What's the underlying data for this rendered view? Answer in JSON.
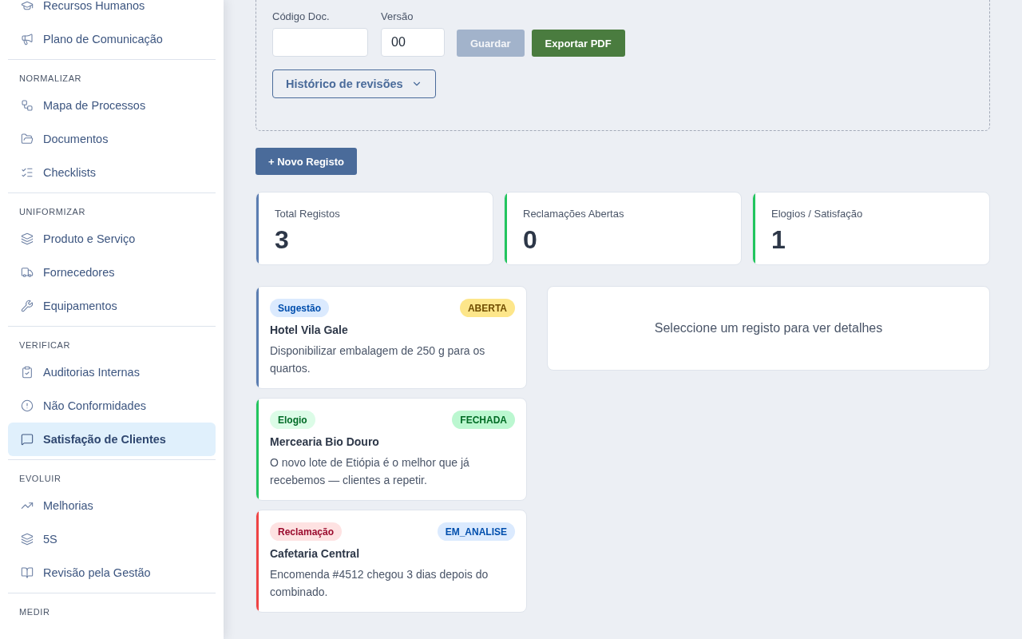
{
  "sidebar": {
    "sections": [
      {
        "items": [
          {
            "label": "Recursos Humanos",
            "selected": false
          },
          {
            "label": "Plano de Comunicação",
            "selected": false
          }
        ]
      },
      {
        "heading": "NORMALIZAR",
        "items": [
          {
            "label": "Mapa de Processos",
            "selected": false
          },
          {
            "label": "Documentos",
            "selected": false
          },
          {
            "label": "Checklists",
            "selected": false
          }
        ]
      },
      {
        "heading": "UNIFORMIZAR",
        "items": [
          {
            "label": "Produto e Serviço",
            "selected": false
          },
          {
            "label": "Fornecedores",
            "selected": false
          },
          {
            "label": "Equipamentos",
            "selected": false
          }
        ]
      },
      {
        "heading": "VERIFICAR",
        "items": [
          {
            "label": "Auditorias Internas",
            "selected": false
          },
          {
            "label": "Não Conformidades",
            "selected": false
          },
          {
            "label": "Satisfação de Clientes",
            "selected": true
          }
        ]
      },
      {
        "heading": "EVOLUIR",
        "items": [
          {
            "label": "Melhorias",
            "selected": false
          },
          {
            "label": "5S",
            "selected": false
          },
          {
            "label": "Revisão pela Gestão",
            "selected": false
          }
        ]
      },
      {
        "heading": "MEDIR"
      }
    ]
  },
  "document_form": {
    "fields": [
      {
        "label": "Código Doc."
      },
      {
        "label": "Versão",
        "value": "00"
      }
    ],
    "buttons": [
      {
        "label": "Guardar",
        "kind": "primary",
        "disabled": true
      },
      {
        "label": "Exportar PDF",
        "kind": "success",
        "disabled": false
      }
    ],
    "history": {
      "label": "Histórico de revisões",
      "expanded": false
    }
  },
  "new_record_button": "+ Novo Registo",
  "stats": [
    {
      "label": "Total Registos",
      "value": "3",
      "color": "#5b7db1"
    },
    {
      "label": "Reclamações Abertas",
      "value": "0",
      "color": "#22c55e"
    },
    {
      "label": "Elogios / Satisfação",
      "value": "1",
      "color": "#22c55e"
    }
  ],
  "records": [
    {
      "tag": {
        "label": "Sugestão",
        "color": "#dbeafe"
      },
      "status": {
        "label": "ABERTA",
        "color": "#fde68a"
      },
      "title": "Hotel Vila Gale",
      "text": "Disponibilizar embalagem de 250 g para os quartos.",
      "color": "#5b7db1",
      "selected": false
    },
    {
      "tag": {
        "label": "Elogio",
        "color": "#dcfce7"
      },
      "status": {
        "label": "FECHADA",
        "color": "#bbf7d0"
      },
      "title": "Mercearia Bio Douro",
      "text": "O novo lote de Etiópia é o melhor que já recebemos — clientes a repetir.",
      "color": "#22c55e",
      "selected": false
    },
    {
      "tag": {
        "label": "Reclamação",
        "color": "#fee2e2"
      },
      "status": {
        "label": "EM_ANALISE",
        "color": "#dbeafe"
      },
      "title": "Cafetaria Central",
      "text": "Encomenda #4512 chegou 3 dias depois do combinado.",
      "color": "#ef4444",
      "selected": false
    }
  ],
  "detail": {
    "message": "Seleccione um registo para ver detalhes"
  }
}
